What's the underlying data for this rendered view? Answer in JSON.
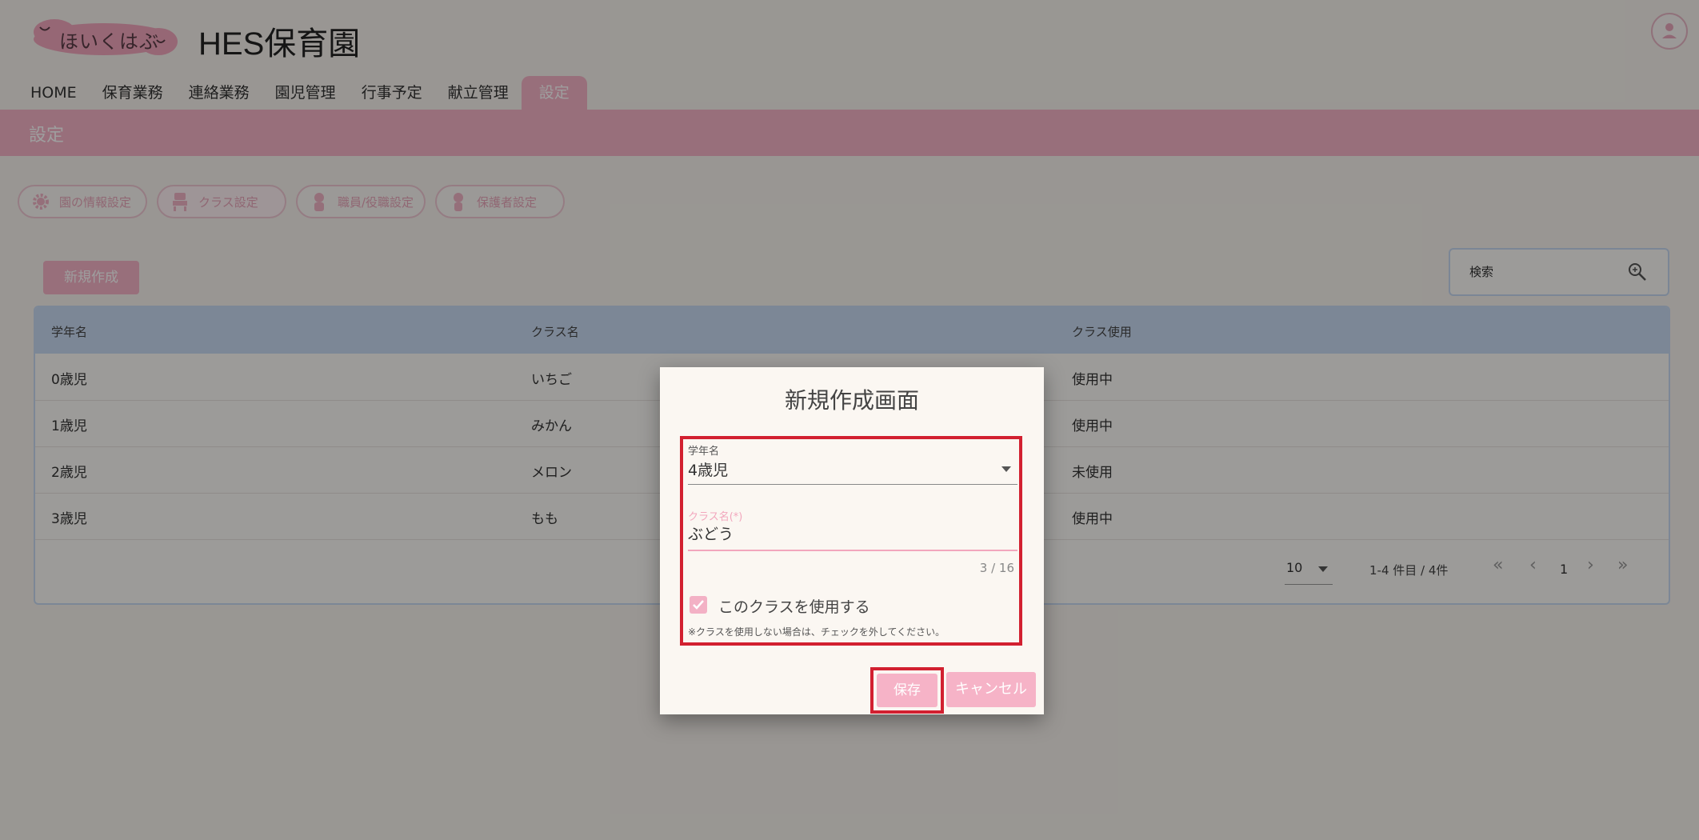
{
  "header": {
    "logo_text": "ほいくはぶ",
    "app_title": "HES保育園"
  },
  "nav": {
    "items": [
      {
        "label": "HOME"
      },
      {
        "label": "保育業務"
      },
      {
        "label": "連絡業務"
      },
      {
        "label": "園児管理"
      },
      {
        "label": "行事予定"
      },
      {
        "label": "献立管理"
      },
      {
        "label": "設定"
      }
    ],
    "active": "設定"
  },
  "page_title": "設定",
  "subtabs": [
    {
      "label": "園の情報設定",
      "icon": "gear-icon"
    },
    {
      "label": "クラス設定",
      "icon": "class-icon"
    },
    {
      "label": "職員/役職設定",
      "icon": "staff-icon"
    },
    {
      "label": "保護者設定",
      "icon": "guardian-icon"
    }
  ],
  "toolbar": {
    "new_label": "新規作成",
    "search_placeholder": "検索"
  },
  "table": {
    "columns": [
      "学年名",
      "クラス名",
      "クラス使用"
    ],
    "rows": [
      [
        "0歳児",
        "いちご",
        "使用中"
      ],
      [
        "1歳児",
        "みかん",
        "使用中"
      ],
      [
        "2歳児",
        "メロン",
        "未使用"
      ],
      [
        "3歳児",
        "もも",
        "使用中"
      ]
    ],
    "rows_per_page": "10",
    "range_info": "1-4 件目 / 4件",
    "current_page": "1"
  },
  "dialog": {
    "title": "新規作成画面",
    "grade_label": "学年名",
    "grade_value": "4歳児",
    "class_label": "クラス名(*)",
    "class_value": "ぶどう",
    "counter": "3 / 16",
    "checkbox_label": "このクラスを使用する",
    "checkbox_checked": true,
    "note": "※クラスを使用しない場合は、チェックを外してください。",
    "save_label": "保存",
    "cancel_label": "キャンセル"
  },
  "colors": {
    "accent_pink": "#f6b3c7",
    "table_header_blue": "#c9daf2",
    "highlight_red": "#d22030"
  }
}
